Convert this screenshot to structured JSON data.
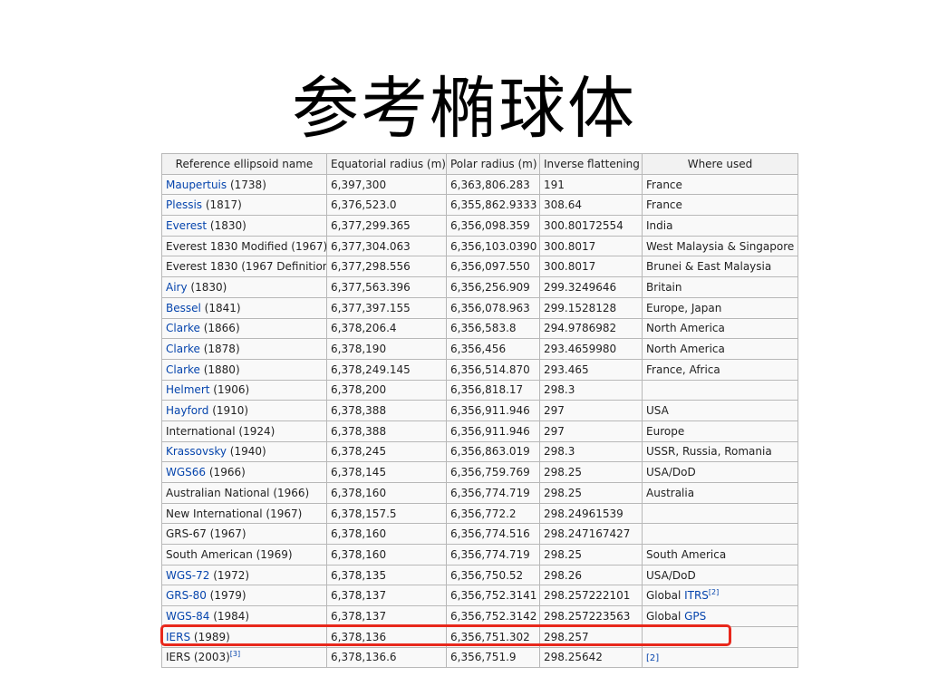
{
  "slide": {
    "title": "参考椭球体"
  },
  "table": {
    "headers": [
      "Reference ellipsoid name",
      "Equatorial radius (m)",
      "Polar radius (m)",
      "Inverse flattening",
      "Where used"
    ],
    "rows": [
      {
        "name": "Maupertuis",
        "linked": true,
        "year": " (1738)",
        "name_sup": "",
        "eq": "6,397,300",
        "polar": "6,363,806.283",
        "inv": "191",
        "where": "France",
        "where_link": "",
        "where_sup": ""
      },
      {
        "name": "Plessis",
        "linked": true,
        "year": " (1817)",
        "name_sup": "",
        "eq": "6,376,523.0",
        "polar": "6,355,862.9333",
        "inv": "308.64",
        "where": "France",
        "where_link": "",
        "where_sup": ""
      },
      {
        "name": "Everest",
        "linked": true,
        "year": " (1830)",
        "name_sup": "",
        "eq": "6,377,299.365",
        "polar": "6,356,098.359",
        "inv": "300.80172554",
        "where": "India",
        "where_link": "",
        "where_sup": ""
      },
      {
        "name": "Everest 1830 Modified",
        "linked": false,
        "year": " (1967)",
        "name_sup": "",
        "eq": "6,377,304.063",
        "polar": "6,356,103.0390",
        "inv": "300.8017",
        "where": "West Malaysia & Singapore",
        "where_link": "",
        "where_sup": ""
      },
      {
        "name": "Everest 1830",
        "linked": false,
        "year": " (1967 Definition)",
        "name_sup": "",
        "eq": "6,377,298.556",
        "polar": "6,356,097.550",
        "inv": "300.8017",
        "where": "Brunei & East Malaysia",
        "where_link": "",
        "where_sup": ""
      },
      {
        "name": "Airy",
        "linked": true,
        "year": " (1830)",
        "name_sup": "",
        "eq": "6,377,563.396",
        "polar": "6,356,256.909",
        "inv": "299.3249646",
        "where": "Britain",
        "where_link": "",
        "where_sup": ""
      },
      {
        "name": "Bessel",
        "linked": true,
        "year": " (1841)",
        "name_sup": "",
        "eq": "6,377,397.155",
        "polar": "6,356,078.963",
        "inv": "299.1528128",
        "where": "Europe, Japan",
        "where_link": "",
        "where_sup": ""
      },
      {
        "name": "Clarke",
        "linked": true,
        "year": " (1866)",
        "name_sup": "",
        "eq": "6,378,206.4",
        "polar": "6,356,583.8",
        "inv": "294.9786982",
        "where": "North America",
        "where_link": "",
        "where_sup": ""
      },
      {
        "name": "Clarke",
        "linked": true,
        "year": " (1878)",
        "name_sup": "",
        "eq": "6,378,190",
        "polar": "6,356,456",
        "inv": "293.4659980",
        "where": "North America",
        "where_link": "",
        "where_sup": ""
      },
      {
        "name": "Clarke",
        "linked": true,
        "year": " (1880)",
        "name_sup": "",
        "eq": "6,378,249.145",
        "polar": "6,356,514.870",
        "inv": "293.465",
        "where": "France, Africa",
        "where_link": "",
        "where_sup": ""
      },
      {
        "name": "Helmert",
        "linked": true,
        "year": " (1906)",
        "name_sup": "",
        "eq": "6,378,200",
        "polar": "6,356,818.17",
        "inv": "298.3",
        "where": "",
        "where_link": "",
        "where_sup": ""
      },
      {
        "name": "Hayford",
        "linked": true,
        "year": " (1910)",
        "name_sup": "",
        "eq": "6,378,388",
        "polar": "6,356,911.946",
        "inv": "297",
        "where": "USA",
        "where_link": "",
        "where_sup": ""
      },
      {
        "name": "International",
        "linked": false,
        "year": " (1924)",
        "name_sup": "",
        "eq": "6,378,388",
        "polar": "6,356,911.946",
        "inv": "297",
        "where": "Europe",
        "where_link": "",
        "where_sup": ""
      },
      {
        "name": "Krassovsky",
        "linked": true,
        "year": " (1940)",
        "name_sup": "",
        "eq": "6,378,245",
        "polar": "6,356,863.019",
        "inv": "298.3",
        "where": "USSR, Russia, Romania",
        "where_link": "",
        "where_sup": ""
      },
      {
        "name": "WGS66",
        "linked": true,
        "year": " (1966)",
        "name_sup": "",
        "eq": "6,378,145",
        "polar": "6,356,759.769",
        "inv": "298.25",
        "where": "USA/DoD",
        "where_link": "",
        "where_sup": ""
      },
      {
        "name": "Australian National",
        "linked": false,
        "year": " (1966)",
        "name_sup": "",
        "eq": "6,378,160",
        "polar": "6,356,774.719",
        "inv": "298.25",
        "where": "Australia",
        "where_link": "",
        "where_sup": ""
      },
      {
        "name": "New International",
        "linked": false,
        "year": " (1967)",
        "name_sup": "",
        "eq": "6,378,157.5",
        "polar": "6,356,772.2",
        "inv": "298.24961539",
        "where": "",
        "where_link": "",
        "where_sup": ""
      },
      {
        "name": "GRS-67",
        "linked": false,
        "year": " (1967)",
        "name_sup": "",
        "eq": "6,378,160",
        "polar": "6,356,774.516",
        "inv": "298.247167427",
        "where": "",
        "where_link": "",
        "where_sup": ""
      },
      {
        "name": "South American",
        "linked": false,
        "year": " (1969)",
        "name_sup": "",
        "eq": "6,378,160",
        "polar": "6,356,774.719",
        "inv": "298.25",
        "where": "South America",
        "where_link": "",
        "where_sup": ""
      },
      {
        "name": "WGS-72",
        "linked": true,
        "year": " (1972)",
        "name_sup": "",
        "eq": "6,378,135",
        "polar": "6,356,750.52",
        "inv": "298.26",
        "where": "USA/DoD",
        "where_link": "",
        "where_sup": ""
      },
      {
        "name": "GRS-80",
        "linked": true,
        "year": " (1979)",
        "name_sup": "",
        "eq": "6,378,137",
        "polar": "6,356,752.3141",
        "inv": "298.257222101",
        "where": "Global ",
        "where_link": "ITRS",
        "where_sup": "[2]"
      },
      {
        "name": "WGS-84",
        "linked": true,
        "year": " (1984)",
        "name_sup": "",
        "eq": "6,378,137",
        "polar": "6,356,752.3142",
        "inv": "298.257223563",
        "where": "Global ",
        "where_link": "GPS",
        "where_sup": ""
      },
      {
        "name": "IERS",
        "linked": true,
        "year": " (1989)",
        "name_sup": "",
        "eq": "6,378,136",
        "polar": "6,356,751.302",
        "inv": "298.257",
        "where": "",
        "where_link": "",
        "where_sup": ""
      },
      {
        "name": "IERS",
        "linked": false,
        "year": " (2003)",
        "name_sup": "[3]",
        "eq": "6,378,136.6",
        "polar": "6,356,751.9",
        "inv": "298.25642",
        "where": "",
        "where_link": "",
        "where_sup": "[2]"
      }
    ]
  },
  "annotation": {
    "highlight_row": "WGS-84",
    "box_color": "#e8281c"
  },
  "colors": {
    "link": "#0645ad",
    "header_bg": "#f2f2f2",
    "cell_bg": "#f9f9f9",
    "border": "#b8b8b8"
  }
}
